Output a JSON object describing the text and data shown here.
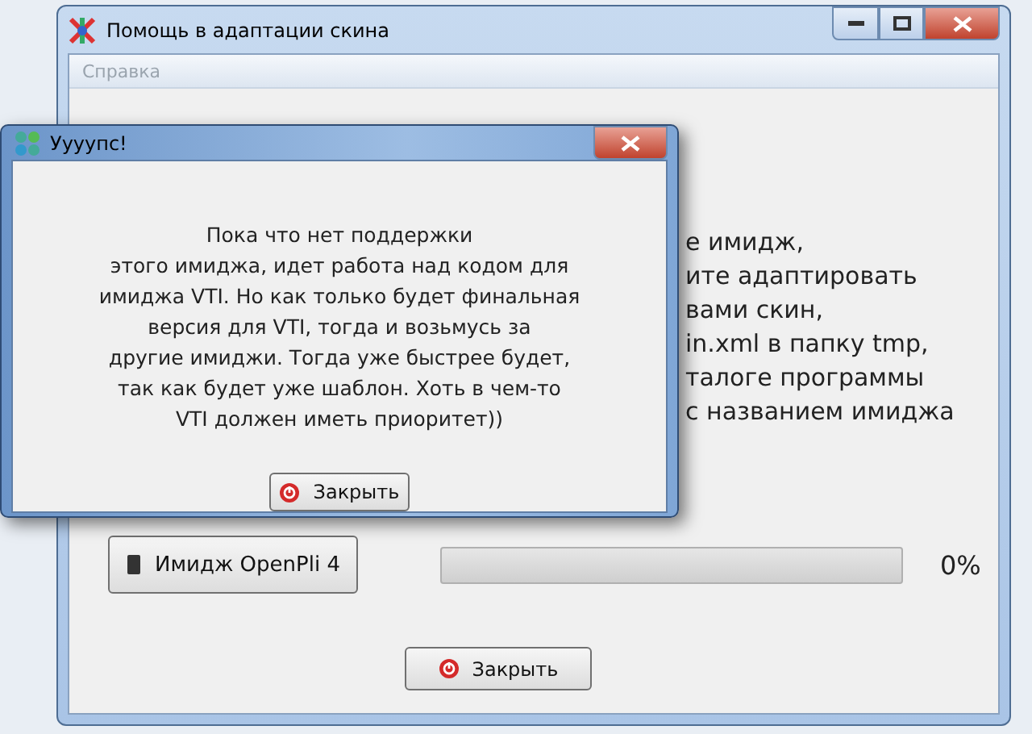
{
  "main_window": {
    "title": "Помощь в адаптации скина",
    "menu": [
      "Справка"
    ],
    "instructions": [
      "е имидж,",
      "ите адаптировать",
      "вами скин,",
      "in.xml в папку tmp,",
      "талоге программы",
      "с названием имиджа"
    ],
    "image_button": "Имидж OpenPli 4",
    "progress": {
      "level": 0,
      "reading": "0%"
    },
    "close_button": "Закрыть"
  },
  "dialog": {
    "title": "Уууупс!",
    "message": [
      "Пока что нет поддержки",
      "этого имиджа, идет работа над кодом для",
      "имиджа VTI. Но как только будет финальная",
      "версия для VTI, тогда и возьмусь за",
      "другие имиджи. Тогда уже быстрее будет,",
      "так как будет уже шаблон. Хоть в чем-то",
      "VTI должен иметь приоритет))"
    ],
    "close_button": "Закрыть"
  }
}
